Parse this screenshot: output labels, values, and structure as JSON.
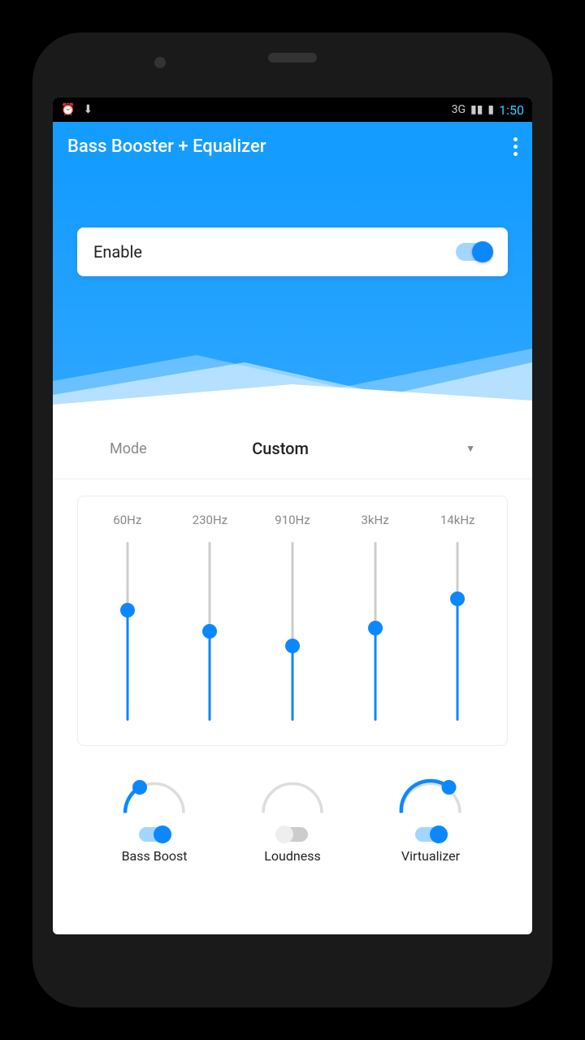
{
  "status": {
    "time": "1:50",
    "network": "3G"
  },
  "app": {
    "title": "Bass Booster + Equalizer"
  },
  "enable": {
    "label": "Enable",
    "value": true
  },
  "mode": {
    "label": "Mode",
    "value": "Custom"
  },
  "equalizer": {
    "bands": [
      {
        "label": "60Hz",
        "value_percent": 62
      },
      {
        "label": "230Hz",
        "value_percent": 50
      },
      {
        "label": "910Hz",
        "value_percent": 42
      },
      {
        "label": "3kHz",
        "value_percent": 52
      },
      {
        "label": "14kHz",
        "value_percent": 68
      }
    ]
  },
  "controls": {
    "bass_boost": {
      "label": "Bass Boost",
      "enabled": true,
      "arc_percent": 35
    },
    "loudness": {
      "label": "Loudness",
      "enabled": false,
      "arc_percent": 0
    },
    "virtualizer": {
      "label": "Virtualizer",
      "enabled": true,
      "arc_percent": 75
    }
  },
  "colors": {
    "primary": "#0b88ff",
    "header": "#149cff"
  }
}
